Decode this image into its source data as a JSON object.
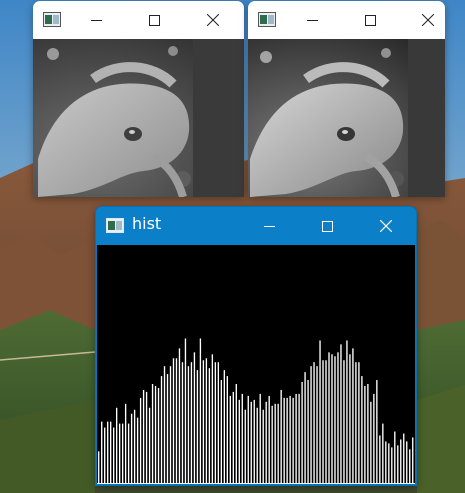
{
  "windows": {
    "image_a": {
      "title": ""
    },
    "image_b": {
      "title": ""
    },
    "histogram": {
      "title": "hist"
    }
  },
  "icons": {
    "app": "opencv-window-icon",
    "minimize": "minimize-icon",
    "maximize": "maximize-icon",
    "close": "close-icon"
  },
  "colors": {
    "hist_titlebar": "#0b7fc7",
    "hist_background": "#000000",
    "hist_bars": "#ffffff",
    "titlebar_light": "#ffffff"
  },
  "chart_data": {
    "type": "bar",
    "title": "",
    "xlabel": "",
    "ylabel": "",
    "xlim": [
      0,
      255
    ],
    "ylim": [
      0,
      100
    ],
    "grid": false,
    "values": [
      16,
      31,
      28,
      31,
      31,
      28,
      38,
      30,
      30,
      40,
      30,
      35,
      37,
      33,
      43,
      47,
      46,
      38,
      50,
      49,
      48,
      54,
      59,
      55,
      59,
      63,
      63,
      68,
      61,
      73,
      59,
      61,
      66,
      57,
      73,
      62,
      63,
      58,
      65,
      61,
      61,
      52,
      57,
      54,
      44,
      46,
      50,
      42,
      45,
      37,
      44,
      41,
      42,
      38,
      45,
      37,
      41,
      44,
      39,
      40,
      40,
      47,
      43,
      43,
      44,
      43,
      45,
      45,
      51,
      56,
      52,
      59,
      61,
      59,
      72,
      62,
      62,
      66,
      65,
      64,
      66,
      70,
      62,
      72,
      65,
      68,
      61,
      61,
      54,
      49,
      50,
      41,
      45,
      52,
      24,
      30,
      21,
      20,
      18,
      26,
      19,
      22,
      25,
      21,
      17,
      23,
      14
    ]
  }
}
